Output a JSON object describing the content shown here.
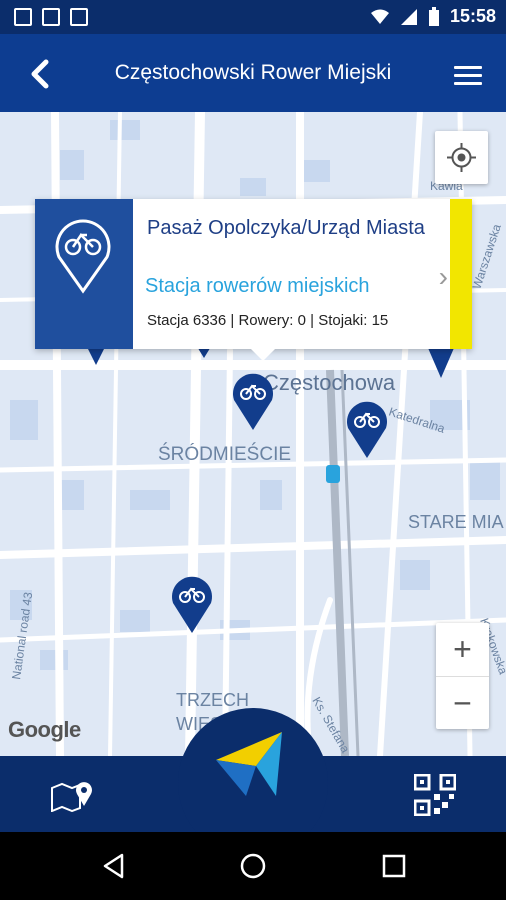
{
  "status_bar": {
    "icons_left": [
      "image-icon",
      "gmail-icon",
      "phone-notification-icon"
    ],
    "time": "15:58",
    "icons_right": [
      "wifi-icon",
      "signal-icon",
      "battery-icon"
    ]
  },
  "header": {
    "title": "Częstochowski Rower Miejski"
  },
  "map": {
    "labels": {
      "city": "Częstochowa",
      "district1": "ŚRÓDMIEŚCIE",
      "district2": "STARE MIA",
      "district3_line1": "TRZECH",
      "district3_line2": "WIESZ",
      "street1": "Kawia",
      "street2": "Warszawska",
      "street3": "Katedralna",
      "street4": "Krakowska",
      "street5": "National road 43",
      "street6": "Ks. Stefana"
    },
    "attribution": "Google",
    "zoom_in": "+",
    "zoom_out": "−"
  },
  "station_popup": {
    "name": "Pasaż Opolczyka/Urząd Miasta",
    "type": "Stacja rowerów miejskich",
    "meta": "Stacja 6336 | Rowery: 0 | Stojaki: 15",
    "accent_color": "#f2e600",
    "arrow": "›"
  },
  "bottom_bar": {
    "left_icon": "map-pin-icon",
    "right_icon": "qr-code-icon"
  },
  "nav_bar": {
    "buttons": [
      "back-triangle",
      "home-circle",
      "recents-square"
    ]
  },
  "colors": {
    "primary": "#0d3d91",
    "dark": "#0b2d6b",
    "accent_blue": "#29a3dd",
    "accent_yellow": "#f2e600",
    "pin": "#1f4f9e"
  }
}
